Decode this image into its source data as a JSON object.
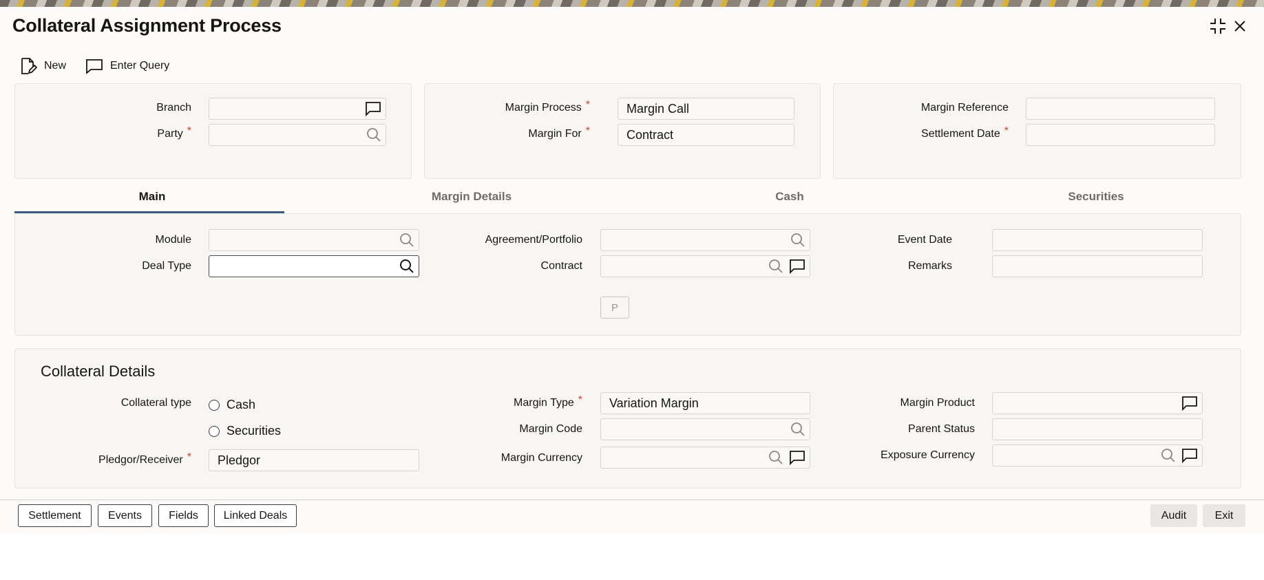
{
  "window": {
    "title": "Collateral Assignment Process",
    "controls": {
      "minimize_icon": "collapse-arrows-icon",
      "close_icon": "close-icon"
    }
  },
  "toolbar": {
    "new_label": "New",
    "enter_query_label": "Enter Query"
  },
  "header": {
    "branch": {
      "label": "Branch",
      "value": ""
    },
    "party": {
      "label": "Party",
      "value": ""
    },
    "margin_process": {
      "label": "Margin Process",
      "value": "Margin Call"
    },
    "margin_for": {
      "label": "Margin For",
      "value": "Contract"
    },
    "margin_reference": {
      "label": "Margin Reference",
      "value": ""
    },
    "settlement_date": {
      "label": "Settlement Date",
      "value": ""
    },
    "required_mark": "*"
  },
  "tabs": [
    {
      "label": "Main",
      "active": true
    },
    {
      "label": "Margin Details",
      "active": false
    },
    {
      "label": "Cash",
      "active": false
    },
    {
      "label": "Securities",
      "active": false
    }
  ],
  "main": {
    "module": {
      "label": "Module",
      "value": ""
    },
    "deal_type": {
      "label": "Deal Type",
      "value": ""
    },
    "agreement_portfolio": {
      "label": "Agreement/Portfolio",
      "value": ""
    },
    "contract": {
      "label": "Contract",
      "value": ""
    },
    "event_date": {
      "label": "Event Date",
      "value": ""
    },
    "remarks": {
      "label": "Remarks",
      "value": ""
    },
    "p_button": "P"
  },
  "collateral_details": {
    "title": "Collateral Details",
    "collateral_type": {
      "label": "Collateral type",
      "options": [
        "Cash",
        "Securities"
      ]
    },
    "pledgor_receiver": {
      "label": "Pledgor/Receiver",
      "value": "Pledgor"
    },
    "margin_type": {
      "label": "Margin Type",
      "value": "Variation Margin"
    },
    "margin_code": {
      "label": "Margin Code",
      "value": ""
    },
    "margin_currency": {
      "label": "Margin Currency",
      "value": ""
    },
    "margin_product": {
      "label": "Margin Product",
      "value": ""
    },
    "parent_status": {
      "label": "Parent Status",
      "value": ""
    },
    "exposure_currency": {
      "label": "Exposure Currency",
      "value": ""
    }
  },
  "footer": {
    "buttons": [
      "Settlement",
      "Events",
      "Fields",
      "Linked Deals"
    ],
    "audit_label": "Audit",
    "exit_label": "Exit"
  }
}
